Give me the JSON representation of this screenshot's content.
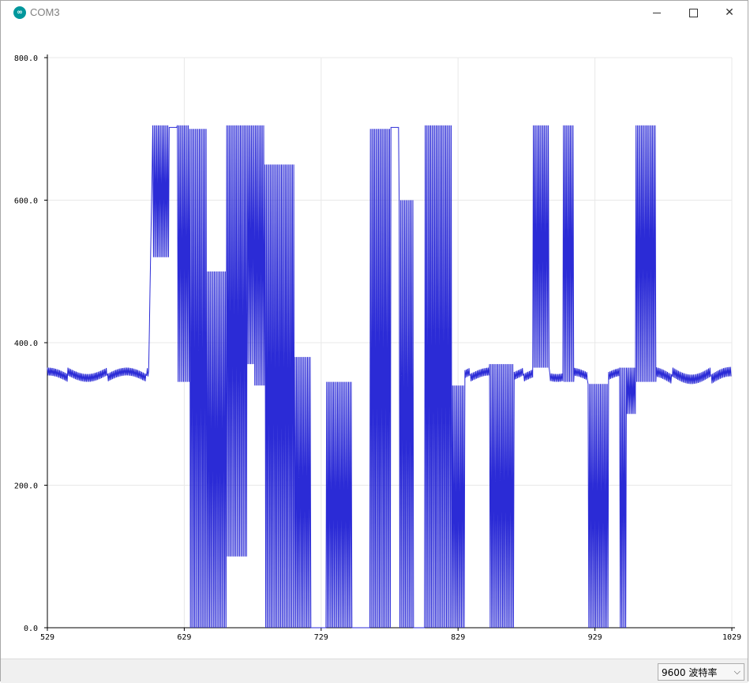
{
  "window": {
    "title": "COM3",
    "app_icon_glyph": "∞",
    "minimize_icon": "minimize-icon",
    "maximize_icon": "maximize-icon",
    "close_glyph": "✕"
  },
  "status": {
    "baud_rate": "9600  波特率",
    "dropdown_glyph": "⌵"
  },
  "colors": {
    "series": "#2b2bd6",
    "grid": "#e8e8e8",
    "axis": "#000000"
  },
  "chart_data": {
    "type": "line",
    "title": "",
    "xlabel": "",
    "ylabel": "",
    "xlim": [
      529,
      1029
    ],
    "ylim": [
      0,
      800
    ],
    "x_ticks": [
      529,
      629,
      729,
      829,
      929,
      1029
    ],
    "y_ticks": [
      0,
      200,
      400,
      600,
      800
    ],
    "x_tick_labels": [
      "529",
      "629",
      "729",
      "829",
      "929",
      "1029"
    ],
    "y_tick_labels": [
      "0.0",
      "200.0",
      "400.0",
      "600.0",
      "800.0"
    ],
    "grid": true,
    "series": [
      {
        "color": "#2b2bd6",
        "segments": [
          {
            "x0": 529,
            "x1": 603,
            "kind": "noise",
            "lo": 345,
            "hi": 365,
            "period": 2
          },
          {
            "x0": 603,
            "x1": 606,
            "kind": "ramp",
            "from": 360,
            "to": 700
          },
          {
            "x0": 606,
            "x1": 618,
            "kind": "osc",
            "lo": 520,
            "hi": 705,
            "period": 2
          },
          {
            "x0": 618,
            "x1": 624,
            "kind": "flat",
            "value": 702
          },
          {
            "x0": 624,
            "x1": 633,
            "kind": "osc",
            "lo": 345,
            "hi": 705,
            "period": 2
          },
          {
            "x0": 633,
            "x1": 646,
            "kind": "osc",
            "lo": 0,
            "hi": 700,
            "period": 2
          },
          {
            "x0": 646,
            "x1": 660,
            "kind": "osc",
            "lo": 0,
            "hi": 500,
            "period": 2
          },
          {
            "x0": 660,
            "x1": 675,
            "kind": "osc",
            "lo": 100,
            "hi": 705,
            "period": 2
          },
          {
            "x0": 675,
            "x1": 680,
            "kind": "osc",
            "lo": 370,
            "hi": 705,
            "period": 2
          },
          {
            "x0": 680,
            "x1": 688,
            "kind": "osc",
            "lo": 340,
            "hi": 705,
            "period": 2
          },
          {
            "x0": 688,
            "x1": 710,
            "kind": "osc",
            "lo": 0,
            "hi": 650,
            "period": 2
          },
          {
            "x0": 710,
            "x1": 722,
            "kind": "osc",
            "lo": 0,
            "hi": 380,
            "period": 2
          },
          {
            "x0": 722,
            "x1": 733,
            "kind": "flat",
            "value": 0
          },
          {
            "x0": 733,
            "x1": 752,
            "kind": "osc",
            "lo": 0,
            "hi": 345,
            "period": 2
          },
          {
            "x0": 752,
            "x1": 765,
            "kind": "flat",
            "value": 0
          },
          {
            "x0": 765,
            "x1": 780,
            "kind": "osc",
            "lo": 0,
            "hi": 700,
            "period": 2
          },
          {
            "x0": 780,
            "x1": 786,
            "kind": "flat",
            "value": 702
          },
          {
            "x0": 786,
            "x1": 797,
            "kind": "osc",
            "lo": 0,
            "hi": 600,
            "period": 2
          },
          {
            "x0": 797,
            "x1": 805,
            "kind": "flat",
            "value": 0
          },
          {
            "x0": 805,
            "x1": 825,
            "kind": "osc",
            "lo": 0,
            "hi": 705,
            "period": 2
          },
          {
            "x0": 825,
            "x1": 834,
            "kind": "osc",
            "lo": 0,
            "hi": 340,
            "period": 2
          },
          {
            "x0": 834,
            "x1": 852,
            "kind": "noise",
            "lo": 345,
            "hi": 365,
            "period": 2
          },
          {
            "x0": 852,
            "x1": 870,
            "kind": "osc",
            "lo": 0,
            "hi": 370,
            "period": 2
          },
          {
            "x0": 870,
            "x1": 884,
            "kind": "noise",
            "lo": 345,
            "hi": 365,
            "period": 2
          },
          {
            "x0": 884,
            "x1": 896,
            "kind": "osc",
            "lo": 365,
            "hi": 705,
            "period": 2
          },
          {
            "x0": 896,
            "x1": 906,
            "kind": "noise",
            "lo": 345,
            "hi": 365,
            "period": 2
          },
          {
            "x0": 906,
            "x1": 914,
            "kind": "osc",
            "lo": 345,
            "hi": 705,
            "period": 2
          },
          {
            "x0": 914,
            "x1": 924,
            "kind": "noise",
            "lo": 345,
            "hi": 365,
            "period": 2
          },
          {
            "x0": 924,
            "x1": 939,
            "kind": "osc",
            "lo": 0,
            "hi": 342,
            "period": 2
          },
          {
            "x0": 939,
            "x1": 947,
            "kind": "noise",
            "lo": 345,
            "hi": 365,
            "period": 2
          },
          {
            "x0": 947,
            "x1": 952,
            "kind": "osc",
            "lo": 0,
            "hi": 365,
            "period": 2
          },
          {
            "x0": 952,
            "x1": 959,
            "kind": "osc",
            "lo": 300,
            "hi": 365,
            "period": 2
          },
          {
            "x0": 959,
            "x1": 974,
            "kind": "osc",
            "lo": 345,
            "hi": 705,
            "period": 2
          },
          {
            "x0": 974,
            "x1": 1029,
            "kind": "noise",
            "lo": 342,
            "hi": 366,
            "period": 2
          }
        ]
      }
    ]
  }
}
